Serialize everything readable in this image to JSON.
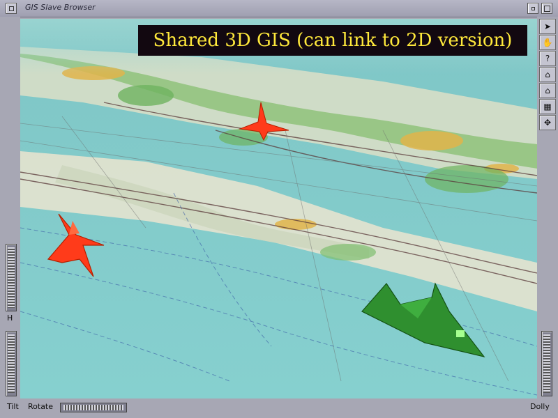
{
  "window": {
    "title": "GIS Slave Browser"
  },
  "banner": {
    "text": "Shared 3D GIS (can link to 2D version)"
  },
  "controls": {
    "h_label": "H",
    "tilt_label": "Tilt",
    "rotate_label": "Rotate",
    "dolly_label": "Dolly"
  },
  "toolbar": {
    "items": [
      {
        "icon": "arrow-pointer-icon",
        "glyph": "➤"
      },
      {
        "icon": "hand-icon",
        "glyph": "✋"
      },
      {
        "icon": "help-icon",
        "glyph": "?"
      },
      {
        "icon": "home-icon",
        "glyph": "⌂"
      },
      {
        "icon": "set-home-icon",
        "glyph": "⌂"
      },
      {
        "icon": "view-all-icon",
        "glyph": "▦"
      },
      {
        "icon": "seek-icon",
        "glyph": "✥"
      }
    ]
  },
  "colors": {
    "water": "#7fc9c9",
    "land": "#d8dfc7",
    "veg": "#7ab86a",
    "urban": "#e3b24a",
    "red_jet": "#ff3b1a",
    "green_jet": "#2f8f2f",
    "banner_text": "#ffe93b"
  }
}
